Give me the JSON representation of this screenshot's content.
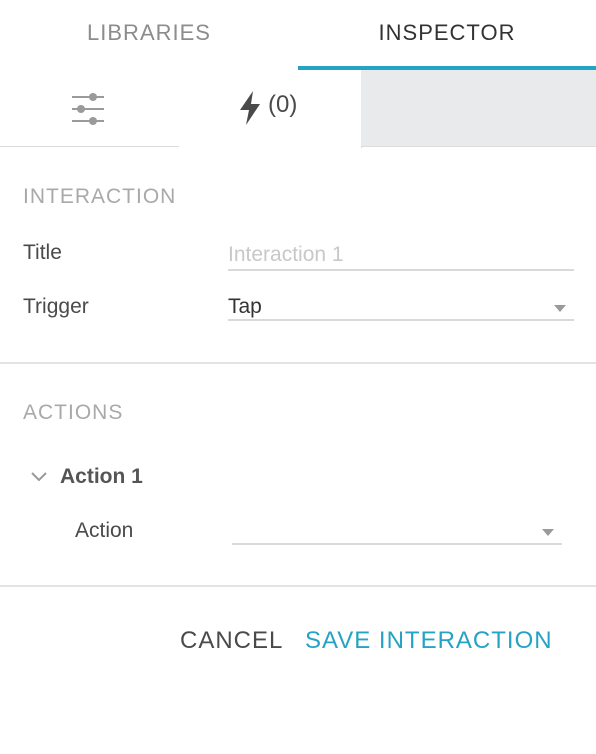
{
  "top_tabs": {
    "libraries": "LIBRARIES",
    "inspector": "INSPECTOR"
  },
  "sub_tabs": {
    "settings_icon": "sliders-icon",
    "interactions_icon": "lightning-bolt-icon",
    "interactions_count": "(0)"
  },
  "interaction": {
    "section_title": "INTERACTION",
    "title_label": "Title",
    "title_placeholder": "Interaction 1",
    "title_value": "",
    "trigger_label": "Trigger",
    "trigger_value": "Tap"
  },
  "actions": {
    "section_title": "ACTIONS",
    "items": [
      {
        "name": "Action 1",
        "action_label": "Action",
        "action_value": ""
      }
    ]
  },
  "buttons": {
    "cancel": "CANCEL",
    "save": "SAVE INTERACTION"
  },
  "colors": {
    "accent": "#26a3c4",
    "tab_inactive_bg": "#e9eaec"
  }
}
